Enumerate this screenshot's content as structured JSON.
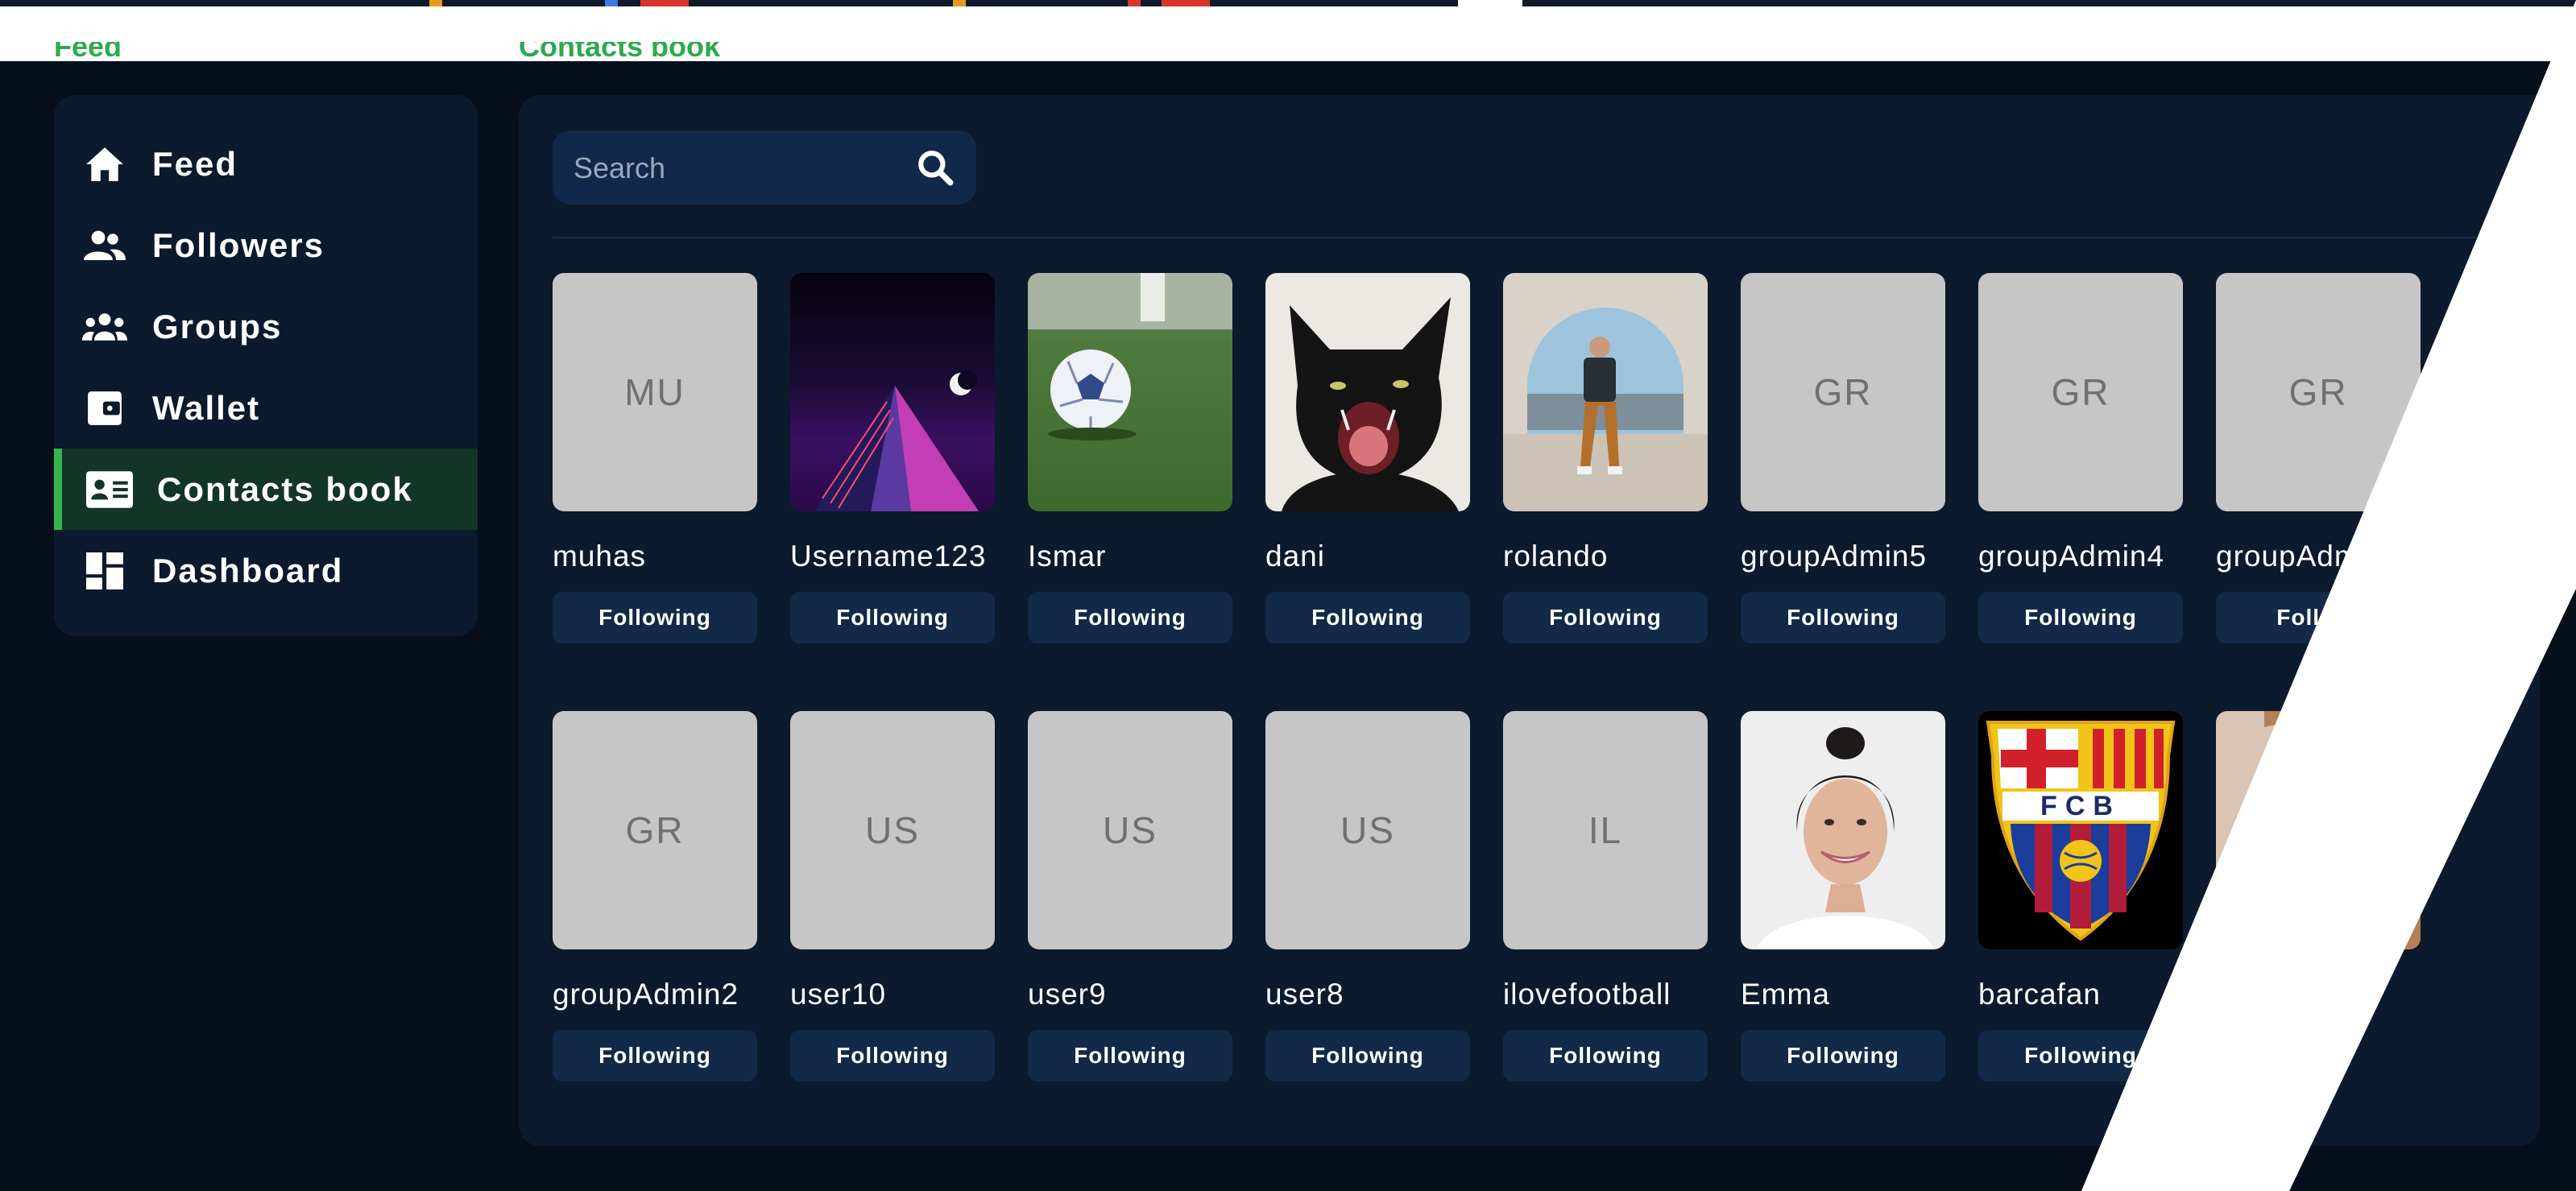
{
  "top_section_labels": {
    "left": "Feed",
    "right": "Contacts book"
  },
  "sidebar": {
    "items": [
      {
        "label": "Feed",
        "icon": "home-icon",
        "active": false
      },
      {
        "label": "Followers",
        "icon": "followers-icon",
        "active": false
      },
      {
        "label": "Groups",
        "icon": "groups-icon",
        "active": false
      },
      {
        "label": "Wallet",
        "icon": "wallet-icon",
        "active": false
      },
      {
        "label": "Contacts book",
        "icon": "contact-card-icon",
        "active": true
      },
      {
        "label": "Dashboard",
        "icon": "dashboard-icon",
        "active": false
      }
    ]
  },
  "search": {
    "placeholder": "Search",
    "value": "",
    "icon": "search-icon"
  },
  "contacts": {
    "row1": [
      {
        "name": "muhas",
        "initials": "MU",
        "button": "Following"
      },
      {
        "name": "Username123",
        "image": "pyramid-artwork",
        "button": "Following"
      },
      {
        "name": "Ismar",
        "image": "soccer-ball-photo",
        "button": "Following"
      },
      {
        "name": "dani",
        "image": "black-cat-photo",
        "button": "Following"
      },
      {
        "name": "rolando",
        "image": "man-sitting-photo",
        "button": "Following"
      },
      {
        "name": "groupAdmin5",
        "initials": "GR",
        "button": "Following"
      },
      {
        "name": "groupAdmin4",
        "initials": "GR",
        "button": "Following"
      },
      {
        "name": "groupAdmi",
        "initials": "GR",
        "button": "Followi"
      }
    ],
    "row2": [
      {
        "name": "groupAdmin2",
        "initials": "GR",
        "button": "Following"
      },
      {
        "name": "user10",
        "initials": "US",
        "button": "Following"
      },
      {
        "name": "user9",
        "initials": "US",
        "button": "Following"
      },
      {
        "name": "user8",
        "initials": "US",
        "button": "Following"
      },
      {
        "name": "ilovefootball",
        "initials": "IL",
        "button": "Following"
      },
      {
        "name": "Emma",
        "image": "woman-portrait-photo",
        "button": "Following"
      },
      {
        "name": "barcafan",
        "image": "fc-barcelona-crest",
        "button": "Following"
      },
      {
        "name": "",
        "image": "partial-portrait-photo",
        "button": ""
      }
    ]
  },
  "crest_letters": "FCB",
  "colors": {
    "background": "#060f1b",
    "panel": "#0b1a2c",
    "accent_green": "#36b553",
    "active_bg": "#133527",
    "button_bg": "#122a48",
    "placeholder_tile": "#c6c6c6"
  }
}
